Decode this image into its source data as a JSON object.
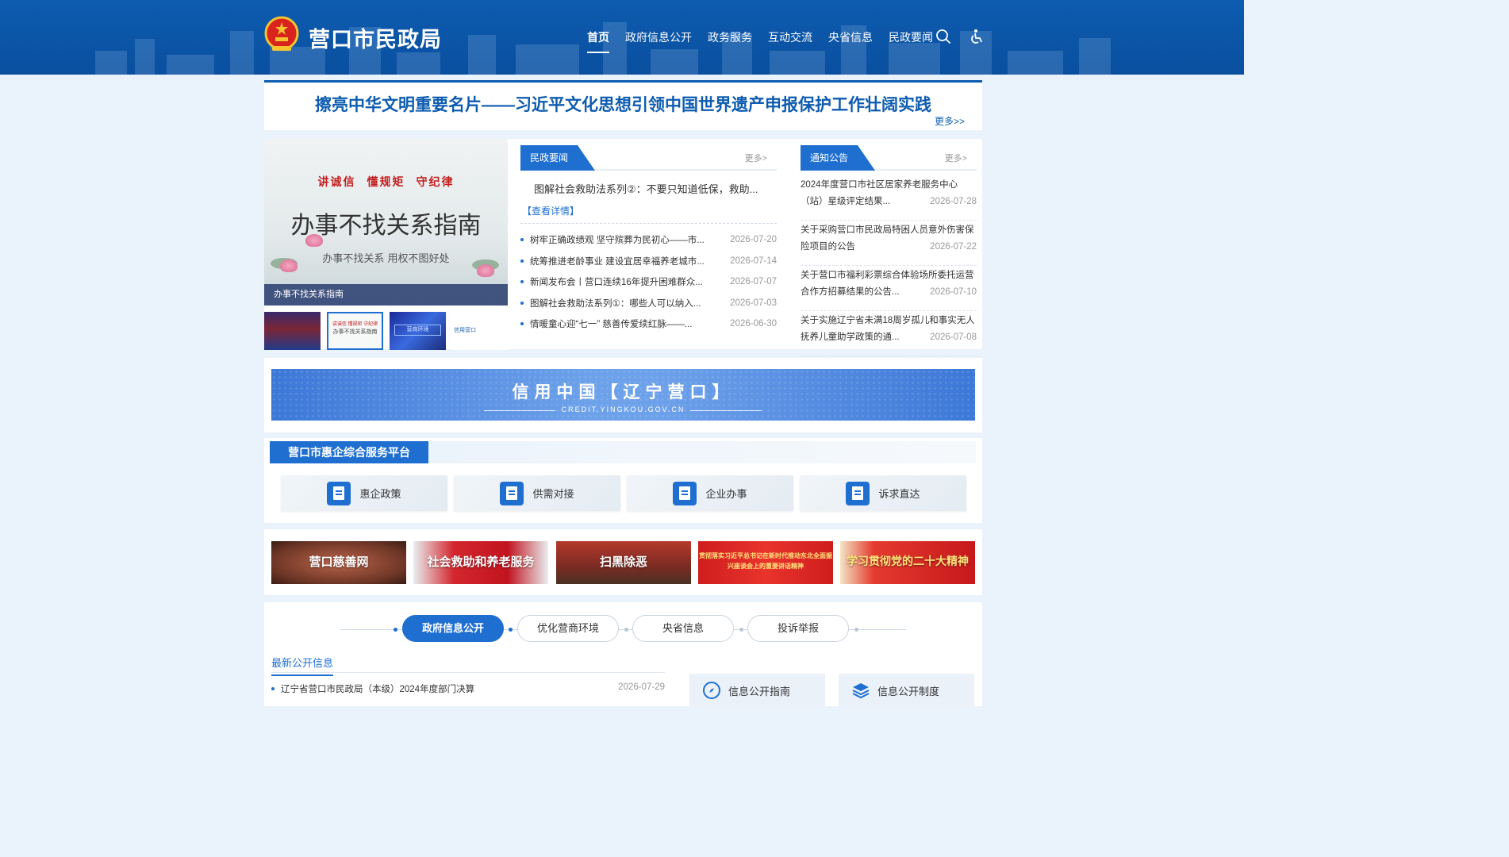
{
  "header": {
    "site_title": "营口市民政局",
    "nav": [
      "首页",
      "政府信息公开",
      "政务服务",
      "互动交流",
      "央省信息",
      "民政要闻"
    ],
    "active_nav": "首页",
    "brand_color": "#0d5cb0"
  },
  "headline": {
    "text": "擦亮中华文明重要名片——习近平文化思想引领中国世界遗产申报保护工作壮阔实践",
    "more": "更多>>"
  },
  "slider": {
    "seals": [
      "讲诚信",
      "懂规矩",
      "守纪律"
    ],
    "main_text": "办事不找关系指南",
    "sub_text": "办事不找关系 用权不图好处",
    "caption": "办事不找关系指南",
    "thumb2_top": "讲诚信 懂规矩 守纪律",
    "thumb2_main": "办事不找关系指南",
    "thumb3_text": "营商环境",
    "thumb4_text": "信用营口"
  },
  "minzheng_news": {
    "tab": "民政要闻",
    "more": "更多>",
    "focus_title": "图解社会救助法系列②：不要只知道低保，救助...",
    "focus_detail": "【查看详情】",
    "items": [
      {
        "title": "树牢正确政绩观 坚守殡葬为民初心——市...",
        "date": "2026-07-20"
      },
      {
        "title": "统筹推进老龄事业 建设宜居幸福养老城市...",
        "date": "2026-07-14"
      },
      {
        "title": "新闻发布会丨营口连续16年提升困难群众...",
        "date": "2026-07-07"
      },
      {
        "title": "图解社会救助法系列①：哪些人可以纳入...",
        "date": "2026-07-03"
      },
      {
        "title": "情暖童心迎“七一” 慈善传爱续红脉——...",
        "date": "2026-06-30"
      }
    ]
  },
  "notices": {
    "tab": "通知公告",
    "more": "更多>",
    "items": [
      {
        "title": "2024年度营口市社区居家养老服务中心（站）星级评定结果...",
        "date": "2026-07-28"
      },
      {
        "title": "关于采购营口市民政局特困人员意外伤害保险项目的公告",
        "date": "2026-07-22"
      },
      {
        "title": "关于营口市福利彩票综合体验场所委托运营合作方招募结果的公告...",
        "date": "2026-07-10"
      },
      {
        "title": "关于实施辽宁省未满18周岁孤儿和事实无人抚养儿童助学政策的通...",
        "date": "2026-07-08"
      }
    ]
  },
  "credit_banner": {
    "title": "信用中国【辽宁营口】",
    "sub": "CREDIT.YINGKOU.GOV.CN"
  },
  "platform": {
    "title": "营口市惠企综合服务平台",
    "items": [
      "惠企政策",
      "供需对接",
      "企业办事",
      "诉求直达"
    ]
  },
  "topics": [
    "营口慈善网",
    "社会救助和养老服务",
    "扫黑除恶",
    "贯彻落实习近平总书记在新时代推动东北全面振兴座谈会上的重要讲话精神",
    "学习贯彻党的二十大精神"
  ],
  "bottom": {
    "tabs": [
      "政府信息公开",
      "优化营商环境",
      "央省信息",
      "投诉举报"
    ],
    "active_tab": "政府信息公开",
    "latest_title": "最新公开信息",
    "latest_items": [
      {
        "title": "辽宁省营口市民政局（本级）2024年度部门决算",
        "date": "2026-07-29"
      }
    ],
    "guides": [
      {
        "label": "信息公开指南",
        "icon": "compass-icon"
      },
      {
        "label": "信息公开制度",
        "icon": "layers-icon"
      }
    ]
  },
  "colors": {
    "accent": "#1f6fd1",
    "header": "#0d5cb0",
    "background": "#eaf2fb"
  }
}
